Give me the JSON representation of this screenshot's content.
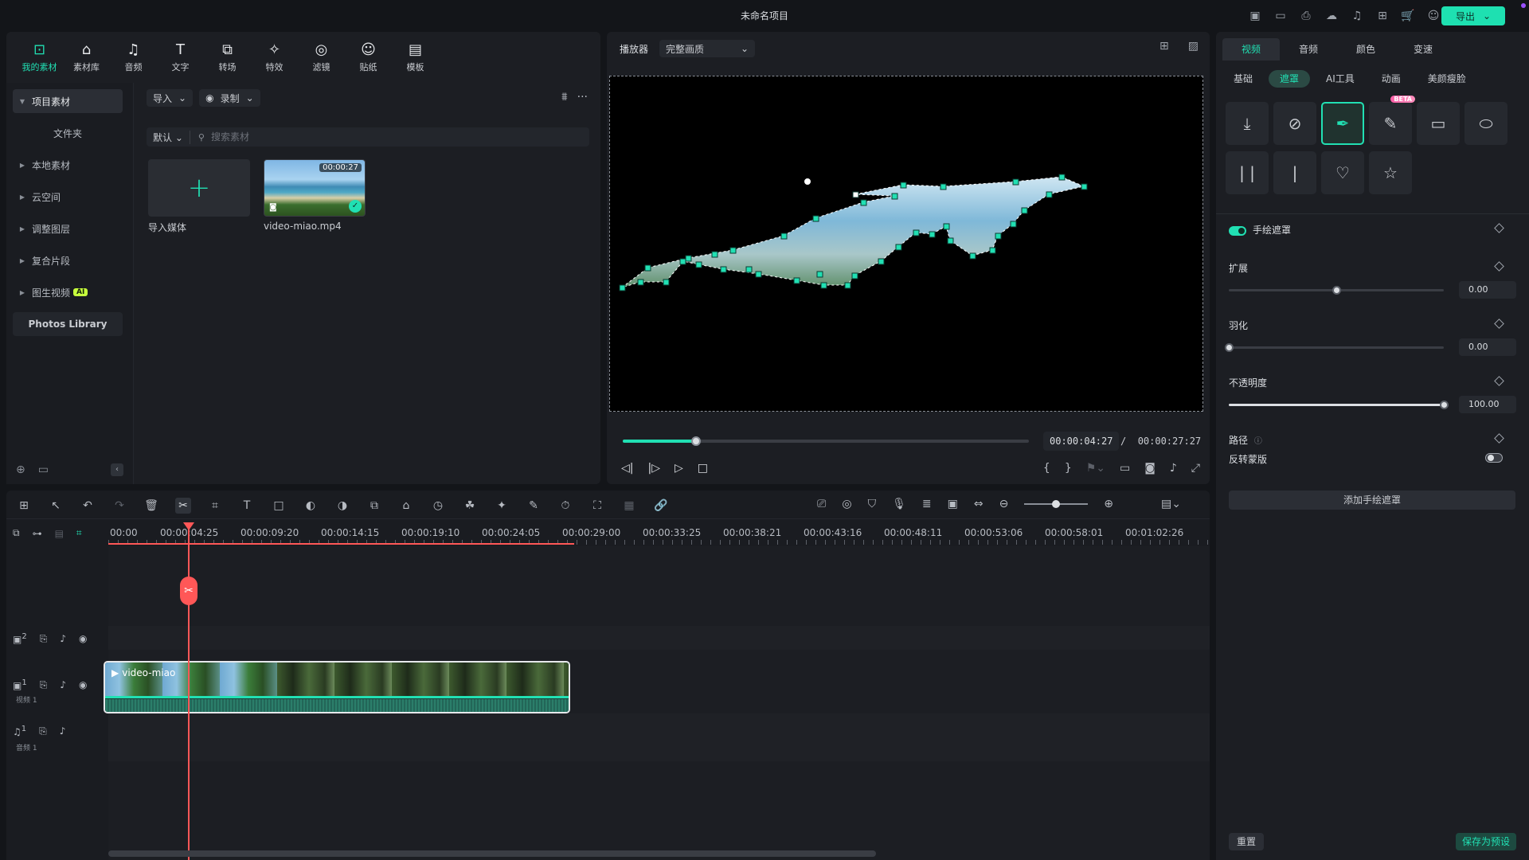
{
  "app": {
    "title": "未命名项目",
    "export_label": "导出",
    "accent": "#21e0b3"
  },
  "top_icons": [
    "device-icon",
    "layout-icon",
    "save-icon",
    "cloud-icon",
    "headset-icon",
    "grid-icon",
    "cart-icon",
    "user-icon"
  ],
  "media": {
    "tabs": [
      {
        "label": "我的素材",
        "icon": "my-media-icon"
      },
      {
        "label": "素材库",
        "icon": "library-icon"
      },
      {
        "label": "音频",
        "icon": "music-icon"
      },
      {
        "label": "文字",
        "icon": "text-icon"
      },
      {
        "label": "转场",
        "icon": "transition-icon"
      },
      {
        "label": "特效",
        "icon": "effects-icon"
      },
      {
        "label": "滤镜",
        "icon": "filter-icon"
      },
      {
        "label": "贴纸",
        "icon": "sticker-icon"
      },
      {
        "label": "模板",
        "icon": "template-icon"
      }
    ],
    "sidebar": {
      "project": "项目素材",
      "folder": "文件夹",
      "items": [
        "本地素材",
        "云空间",
        "调整图层",
        "复合片段",
        "图生视频"
      ],
      "ai_badge": "AI",
      "photos": "Photos Library"
    },
    "import_label": "导入",
    "record_label": "录制",
    "sort_label": "默认",
    "search_placeholder": "搜索素材",
    "import_media_label": "导入媒体",
    "clip": {
      "name": "video-miao.mp4",
      "duration": "00:00:27"
    }
  },
  "player": {
    "label": "播放器",
    "quality": "完整画质",
    "current_time": "00:00:04:27",
    "separator": "/",
    "total_time": "00:00:27:27",
    "progress": 0.18
  },
  "inspector": {
    "tabs": [
      "视频",
      "音频",
      "颜色",
      "变速"
    ],
    "subtabs": [
      "基础",
      "遮罩",
      "AI工具",
      "动画",
      "美颜瘦脸"
    ],
    "beta_label": "BETA",
    "hand_mask_label": "手绘遮罩",
    "expand": {
      "label": "扩展",
      "value": "0.00",
      "level": 0.5
    },
    "feather": {
      "label": "羽化",
      "value": "0.00",
      "level": 0.0
    },
    "opacity": {
      "label": "不透明度",
      "value": "100.00",
      "level": 1.0
    },
    "path_label": "路径",
    "invert_label": "反转蒙版",
    "add_mask_label": "添加手绘遮罩",
    "reset_label": "重置",
    "save_preset_label": "保存为预设"
  },
  "timeline": {
    "ticks": [
      "00:00",
      "00:00:04:25",
      "00:00:09:20",
      "00:00:14:15",
      "00:00:19:10",
      "00:00:24:05",
      "00:00:29:00",
      "00:00:33:25",
      "00:00:38:21",
      "00:00:43:16",
      "00:00:48:11",
      "00:00:53:06",
      "00:00:58:01",
      "00:01:02:26"
    ],
    "tracks": {
      "video2_num": "2",
      "video1_num": "1",
      "video1_label": "视频 1",
      "audio1_num": "1",
      "audio1_label": "音频 1"
    },
    "clip_title": "video-miao"
  }
}
